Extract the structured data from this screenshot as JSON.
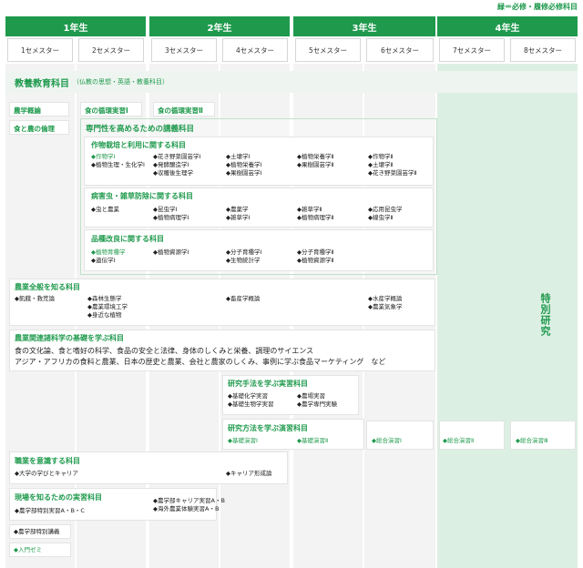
{
  "legend": "緑＝必修・履修必修科目",
  "years": [
    "1年生",
    "2年生",
    "3年生",
    "4年生"
  ],
  "semesters": [
    "1セメスター",
    "2セメスター",
    "3セメスター",
    "4セメスター",
    "5セメスター",
    "6セメスター",
    "7セメスター",
    "8セメスター"
  ],
  "liberal": {
    "title": "教養教育科目",
    "sub": "（仏教の思想・英語・教養科目）"
  },
  "basic": {
    "nogaku": "農学概論",
    "shoku_nou": "食と農の倫理",
    "junkan1": "食の循環実習Ⅰ",
    "junkan2": "食の循環実習Ⅱ"
  },
  "specialty": {
    "title": "専門性を高めるための講義科目",
    "crop": {
      "title": "作物栽培と利用に関する科目",
      "s2": [
        "◆作物学Ⅰ",
        "◆植物生理・生化学Ⅰ"
      ],
      "s3": [
        "◆花き野菜園芸学Ⅰ",
        "◆発酵醸造学Ⅰ",
        "◆収穫後生理学"
      ],
      "s4": [
        "◆土壌学Ⅰ",
        "◆植物栄養学Ⅰ",
        "◆果樹園芸学Ⅰ"
      ],
      "s5": [
        "◆植物栄養学Ⅱ",
        "◆果樹園芸学Ⅱ"
      ],
      "s6": [
        "◆作物学Ⅱ",
        "◆土壌学Ⅱ",
        "◆花き野菜園芸学Ⅱ"
      ]
    },
    "pest": {
      "title": "病害虫・雑草防除に関する科目",
      "s2": [
        "◆虫と農業"
      ],
      "s3": [
        "◆昆虫学Ⅰ",
        "◆植物病理学Ⅰ"
      ],
      "s4": [
        "◆農薬学",
        "◆雑草学Ⅰ"
      ],
      "s5": [
        "◆雑草学Ⅱ",
        "◆植物病理学Ⅱ"
      ],
      "s6": [
        "◆応用昆虫学",
        "◆線虫学Ⅱ"
      ]
    },
    "breed": {
      "title": "品種改良に関する科目",
      "s2": [
        "◆植物育種学",
        "◆遺伝学Ⅰ"
      ],
      "s3": [
        "◆植物資源学Ⅰ"
      ],
      "s4": [
        "◆分子育種学Ⅰ",
        "◆生物統計学"
      ],
      "s5": [
        "◆分子育種学Ⅱ",
        "◆植物資源学Ⅱ"
      ]
    }
  },
  "overall": {
    "title": "農業全般を知る科目",
    "s1": [
      "◆飢餓・救荒論"
    ],
    "s2": [
      "◆森林生態学",
      "◆農業環境工学",
      "◆身近な植物"
    ],
    "s4": [
      "◆畜産学概論"
    ],
    "s6": [
      "◆水産学概論",
      "◆農業気象学"
    ]
  },
  "special_research": "特別研究",
  "related": {
    "title": "農業関連諸科学の基礎を学ぶ科目",
    "line1": "食の文化論、食と嗜好の科学、食品の安全と法律、身体のしくみと栄養、調理のサイエンス",
    "line2": "アジア・アフリカの食料と農業、日本の歴史と農業、会社と農家のしくみ、事例に学ぶ食品マーケティング　など"
  },
  "methods": {
    "title": "研究手法を学ぶ実習科目",
    "s4": [
      "◆基礎化学実習",
      "◆基礎生物学実習"
    ],
    "s5": [
      "◆農場実習",
      "◆農学専門実験"
    ]
  },
  "seminar": {
    "title": "研究方法を学ぶ演習科目",
    "s4": "◆基礎演習Ⅰ",
    "s5": "◆基礎演習Ⅱ",
    "s6": "◆総合演習Ⅰ",
    "s7": "◆総合演習Ⅱ",
    "s8": "◆総合演習Ⅲ"
  },
  "career": {
    "title": "職業を意識する科目",
    "s1": "◆大学の学びとキャリア",
    "s4": "◆キャリア形成論"
  },
  "field": {
    "title": "現場を知るための実習科目",
    "s1": "◆農学部特別実習A・B・C",
    "s3": [
      "◆農学部キャリア実習A・B",
      "◆海外農業体験実習A・B"
    ]
  },
  "lecture": "◆農学部特別講義",
  "intro_seminar": "◆入門ゼミ"
}
